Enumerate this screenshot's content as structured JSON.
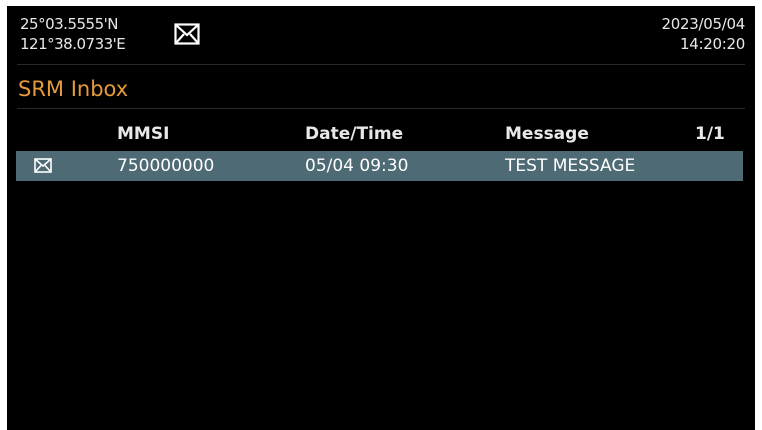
{
  "status": {
    "latitude": "25°03.5555'N",
    "longitude": "121°38.0733'E",
    "mail_icon": "envelope-icon",
    "date": "2023/05/04",
    "time": "14:20:20"
  },
  "title": "SRM Inbox",
  "table": {
    "columns": [
      "MMSI",
      "Date/Time",
      "Message"
    ],
    "page_indicator": "1/1",
    "rows": [
      {
        "icon": "envelope-icon",
        "mmsi": "750000000",
        "datetime": "05/04 09:30",
        "message": "TEST MESSAGE"
      }
    ]
  },
  "colors": {
    "title": "#e59a3c",
    "selected_row": "#4e6a74",
    "background": "#000000"
  }
}
